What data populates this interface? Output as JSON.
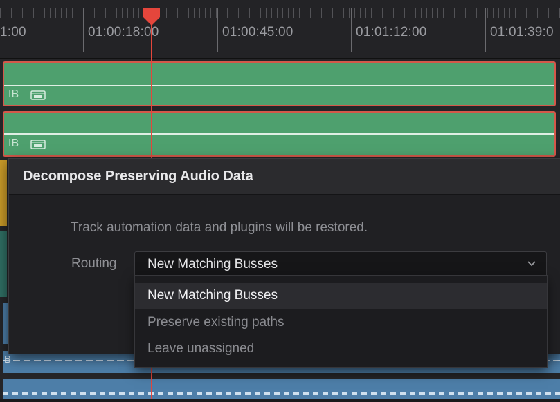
{
  "timeline": {
    "timecodes": [
      "1:00",
      "01:00:18:00",
      "01:00:45:00",
      "01:01:12:00",
      "01:01:39:0"
    ],
    "clip_labels": [
      "IB",
      "IB",
      "B"
    ]
  },
  "dialog": {
    "title": "Decompose Preserving Audio Data",
    "message": "Track automation data and plugins will be restored.",
    "routing_label": "Routing",
    "routing_value": "New Matching Busses"
  },
  "dropdown": {
    "options": [
      "New Matching Busses",
      "Preserve existing paths",
      "Leave unassigned"
    ],
    "selected_index": 0
  },
  "colors": {
    "clip_green": "#4ea06e",
    "clip_border": "#d4584a",
    "playhead": "#e4463c",
    "track_blue": "#4d7ea8"
  }
}
